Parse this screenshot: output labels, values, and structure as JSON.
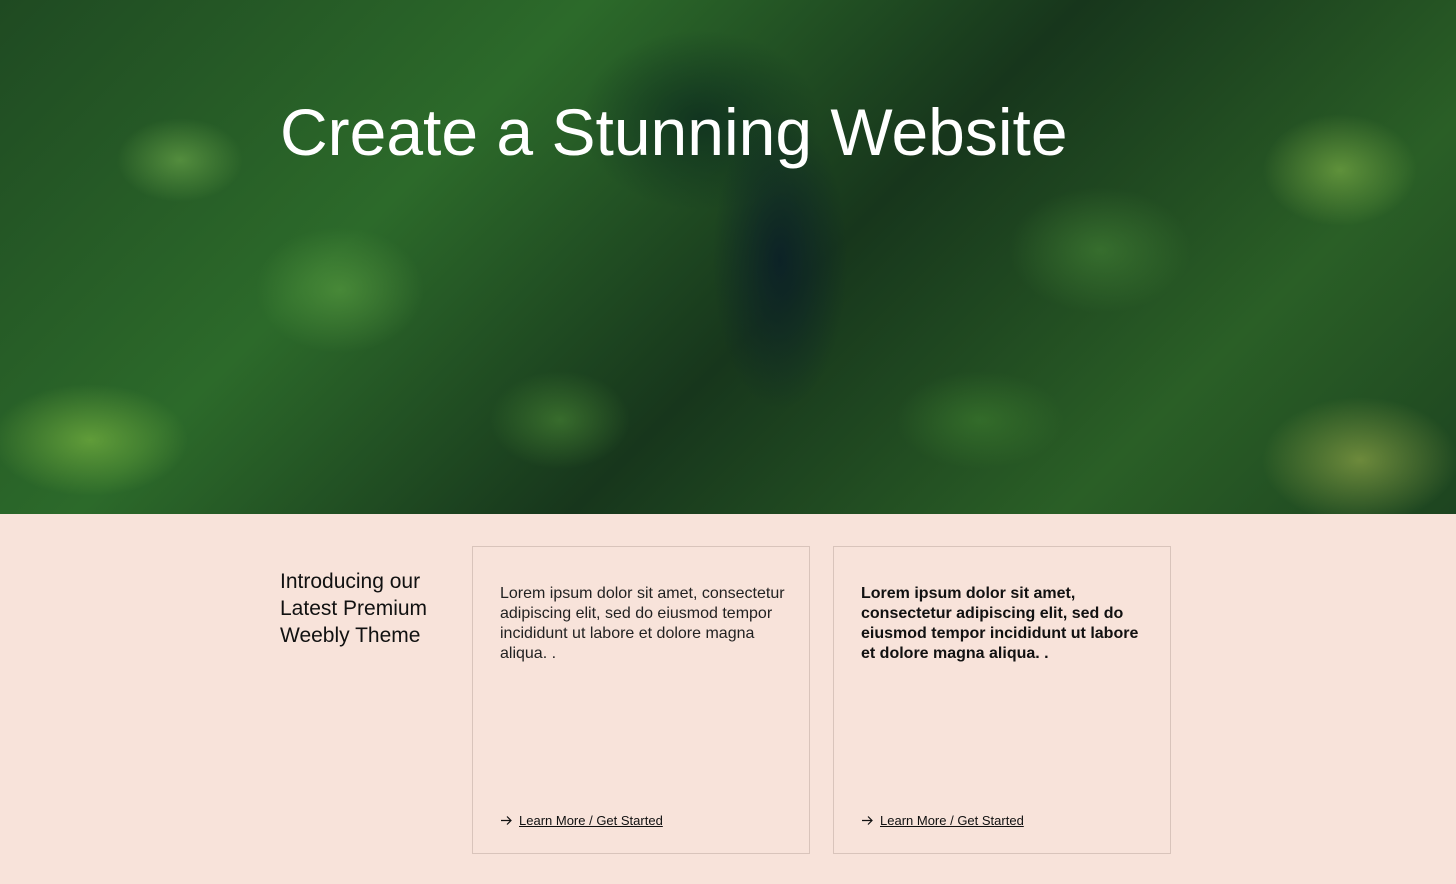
{
  "hero": {
    "title": "Create a Stunning Website"
  },
  "intro": {
    "heading": "Introducing our Latest Premium Weebly Theme"
  },
  "cards": [
    {
      "text": "Lorem ipsum dolor sit amet, consectetur adipiscing elit, sed do eiusmod tempor incididunt ut labore et dolore magna aliqua. .",
      "link_label": "Learn More / Get Started",
      "link_icon": "arrow-right-icon"
    },
    {
      "text": "Lorem ipsum dolor sit amet, consectetur adipiscing elit, sed do eiusmod tempor incididunt ut labore et dolore magna aliqua. .",
      "link_label": "Learn More / Get Started",
      "link_icon": "arrow-right-icon"
    }
  ],
  "colors": {
    "section_background": "#f8e3da",
    "card_border": "#d9c4bb",
    "hero_title": "#ffffff"
  }
}
